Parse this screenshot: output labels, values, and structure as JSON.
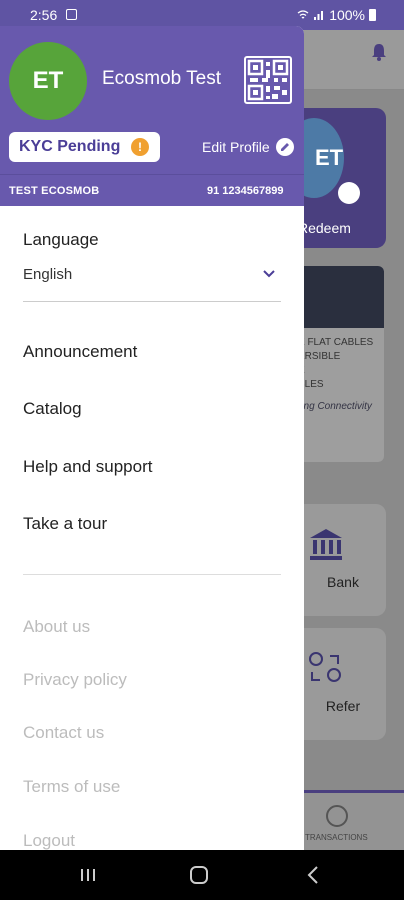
{
  "status_bar": {
    "time": "2:56",
    "battery": "100%"
  },
  "main": {
    "card_initials": "ET",
    "card_action": "Redeem",
    "banner_lines": [
      "E FLAT CABLES",
      "ERSIBLE",
      "E",
      "BLES"
    ],
    "banner_tagline": "ong Connectivity",
    "tiles": [
      {
        "label": "Bank"
      },
      {
        "label": "Refer"
      }
    ],
    "bottom_nav_label": "TRANSACTIONS"
  },
  "drawer": {
    "avatar_initials": "ET",
    "user_name": "Ecosmob Test",
    "kyc_status": "KYC Pending",
    "kyc_warning": "!",
    "edit_profile": "Edit Profile",
    "user_id": "TEST ECOSMOB",
    "user_phone": "91 1234567899",
    "language_title": "Language",
    "language_value": "English",
    "menu": [
      {
        "label": "Announcement"
      },
      {
        "label": "Catalog"
      },
      {
        "label": "Help and support"
      },
      {
        "label": "Take a tour"
      }
    ],
    "secondary_menu": [
      {
        "label": "About us"
      },
      {
        "label": "Privacy policy"
      },
      {
        "label": "Contact us"
      },
      {
        "label": "Terms of use"
      },
      {
        "label": "Logout"
      }
    ]
  },
  "colors": {
    "header_purple": "#6859ad",
    "avatar_green": "#57a43a",
    "warning_orange": "#f0a030"
  }
}
